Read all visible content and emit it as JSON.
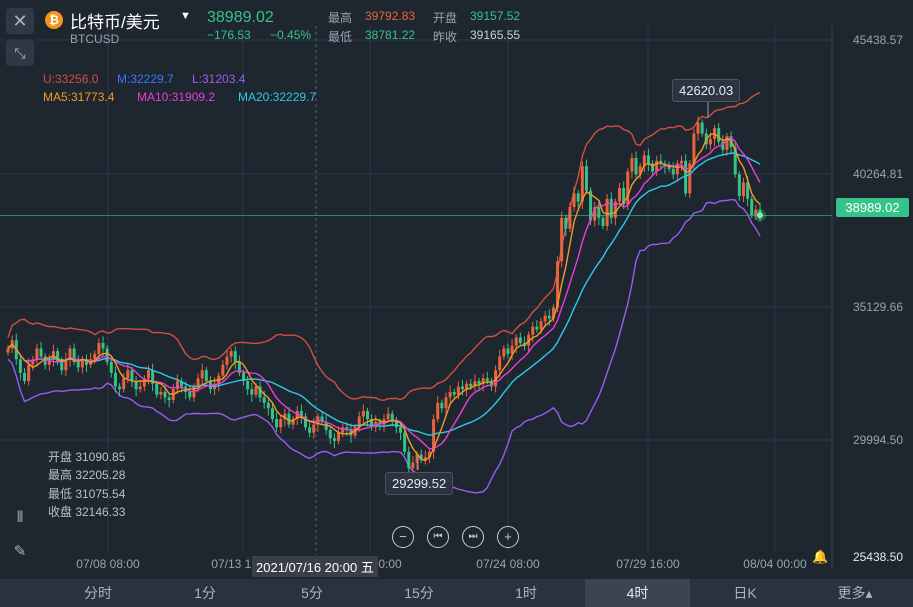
{
  "header": {
    "coin_icon": "bitcoin-icon",
    "symbol_name": "比特币/美元",
    "symbol_code": "BTCUSD",
    "last_price": "38989.02",
    "change": "−176.53",
    "change_percent": "−0.45%",
    "high_label": "最高",
    "high_value": "39792.83",
    "low_label": "最低",
    "low_value": "38781.22",
    "open_label": "开盘",
    "open_value": "39157.52",
    "prev_close_label": "昨收",
    "prev_close_value": "39165.55"
  },
  "indicators": {
    "boll_u": "U:33256.0",
    "boll_m": "M:32229.7",
    "boll_l": "L:31203.4",
    "ma5": "MA5:31773.4",
    "ma10": "MA10:31909.2",
    "ma20": "MA20:32229.7"
  },
  "crosshair_ohlc": {
    "open": "开盘 31090.85",
    "high": "最高 32205.28",
    "low": "最低 31075.54",
    "close": "收盘 32146.33"
  },
  "crosshair_date": "2021/07/16 20:00 五",
  "callouts": {
    "max": "42620.03",
    "min": "29299.52"
  },
  "price_tag": "38989.02",
  "zoom_controls": {
    "zoom_out": "−",
    "prev": "⏮",
    "next": "⏭",
    "zoom_in": "+"
  },
  "timeframes": [
    "分时",
    "1分",
    "5分",
    "15分",
    "1时",
    "4时",
    "日K",
    "更多▴"
  ],
  "active_timeframe": "4时",
  "colors": {
    "up": "#e8643c",
    "down": "#36c389",
    "boll_u": "#d2503e",
    "boll_m": "#3a78ff",
    "boll_l": "#9b5cf0",
    "ma5": "#f59a23",
    "ma10": "#e83fd8",
    "ma20": "#31c8e8"
  },
  "chart_data": {
    "type": "candlestick",
    "interval": "4h",
    "y_ticks": [
      "45438.57",
      "40264.81",
      "35129.66",
      "29994.50",
      "25438.50"
    ],
    "x_ticks": [
      "07/08 08:00",
      "07/13 12:00",
      "07/20 00:00",
      "07/24 08:00",
      "07/29 16:00",
      "08/04 00:00"
    ],
    "ylim": [
      25438.5,
      45438.57
    ],
    "close": [
      34100,
      34400,
      33700,
      33200,
      32900,
      33500,
      33700,
      34100,
      33800,
      33500,
      33700,
      34000,
      33600,
      33300,
      33700,
      34100,
      33600,
      33400,
      33700,
      33500,
      33700,
      33900,
      34300,
      34100,
      33600,
      33200,
      32700,
      32600,
      33000,
      33300,
      32900,
      32600,
      32700,
      33000,
      33300,
      32800,
      32400,
      32500,
      32300,
      32200,
      32600,
      32900,
      32700,
      32500,
      32300,
      32700,
      33000,
      33300,
      32900,
      32600,
      32800,
      33100,
      33500,
      33800,
      34000,
      33600,
      33200,
      32900,
      32600,
      32400,
      32700,
      32300,
      32100,
      31900,
      31500,
      31200,
      31500,
      31700,
      31300,
      31500,
      31800,
      31600,
      31200,
      31000,
      31300,
      31600,
      31400,
      31100,
      30800,
      30700,
      31000,
      31200,
      31100,
      30900,
      31200,
      31600,
      31800,
      31500,
      31200,
      31400,
      31300,
      31500,
      31700,
      31400,
      31200,
      31000,
      30300,
      29700,
      29900,
      30200,
      30000,
      30100,
      30300,
      31500,
      32100,
      31900,
      32300,
      32500,
      32400,
      32700,
      32600,
      32800,
      32700,
      32900,
      32800,
      33000,
      32900,
      32700,
      33300,
      33800,
      34100,
      33900,
      34200,
      34500,
      34300,
      34200,
      34600,
      34900,
      34800,
      35100,
      35300,
      35200,
      35600,
      37300,
      38900,
      38500,
      39300,
      39800,
      39500,
      40800,
      39900,
      38800,
      39300,
      38900,
      38600,
      39600,
      38900,
      39500,
      40000,
      39400,
      40600,
      41100,
      40500,
      40800,
      41200,
      40900,
      40600,
      41000,
      40900,
      40800,
      40700,
      40500,
      40900,
      41000,
      39800,
      40900,
      42000,
      42400,
      42000,
      41600,
      41800,
      42200,
      41700,
      41400,
      41900,
      41500,
      40500,
      39700,
      40200,
      39600,
      39000,
      39200,
      38989
    ],
    "high_marker": 42620.03,
    "low_marker": 29299.52,
    "crosshair_candle": {
      "open": 31090.85,
      "high": 32205.28,
      "low": 31075.54,
      "close": 32146.33
    }
  }
}
